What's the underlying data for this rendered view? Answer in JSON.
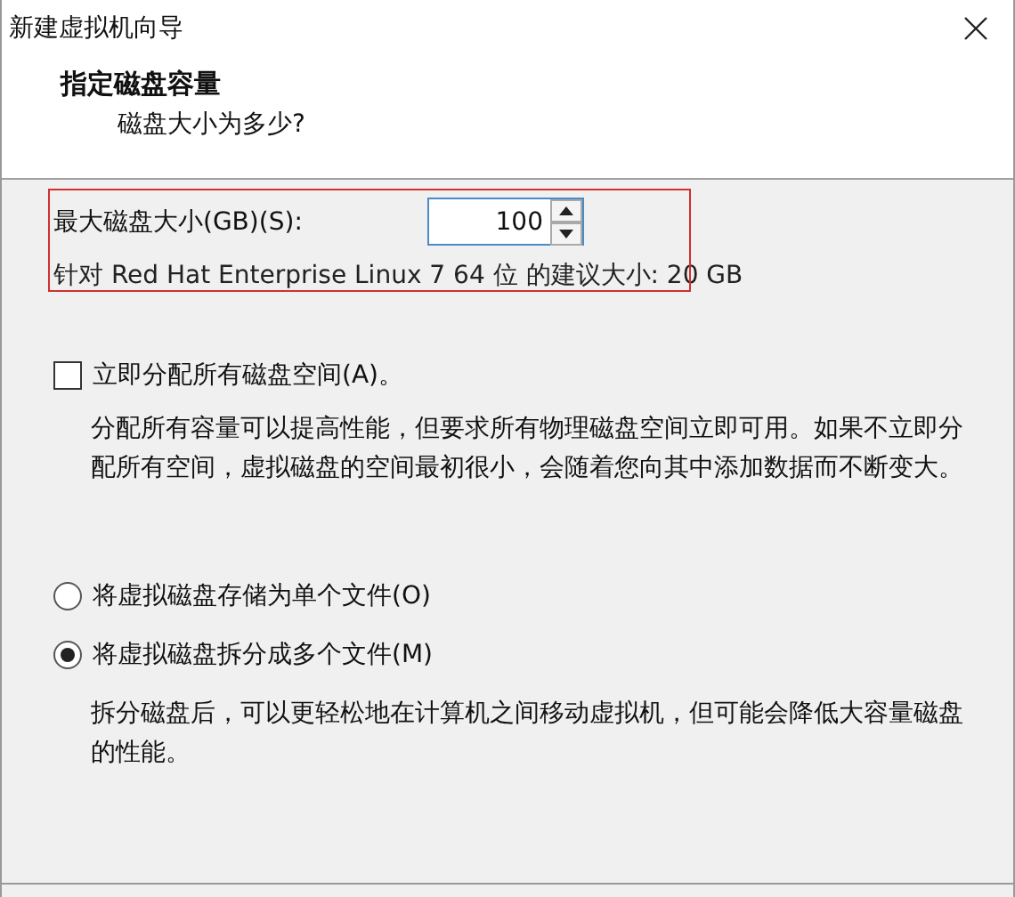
{
  "window": {
    "title": "新建虚拟机向导"
  },
  "header": {
    "title": "指定磁盘容量",
    "subtitle": "磁盘大小为多少?"
  },
  "disk_size": {
    "label": "最大磁盘大小(GB)(S):",
    "value": "100",
    "highlighted": true
  },
  "recommendation": "针对 Red Hat Enterprise Linux 7 64 位 的建议大小: 20 GB",
  "allocate": {
    "label": "立即分配所有磁盘空间(A)。",
    "checked": false,
    "description": "分配所有容量可以提高性能，但要求所有物理磁盘空间立即可用。如果不立即分配所有空间，虚拟磁盘的空间最初很小，会随着您向其中添加数据而不断变大。"
  },
  "storage_options": [
    {
      "label": "将虚拟磁盘存储为单个文件(O)",
      "selected": false
    },
    {
      "label": "将虚拟磁盘拆分成多个文件(M)",
      "selected": true,
      "description": "拆分磁盘后，可以更轻松地在计算机之间移动虚拟机，但可能会降低大容量磁盘的性能。"
    }
  ]
}
